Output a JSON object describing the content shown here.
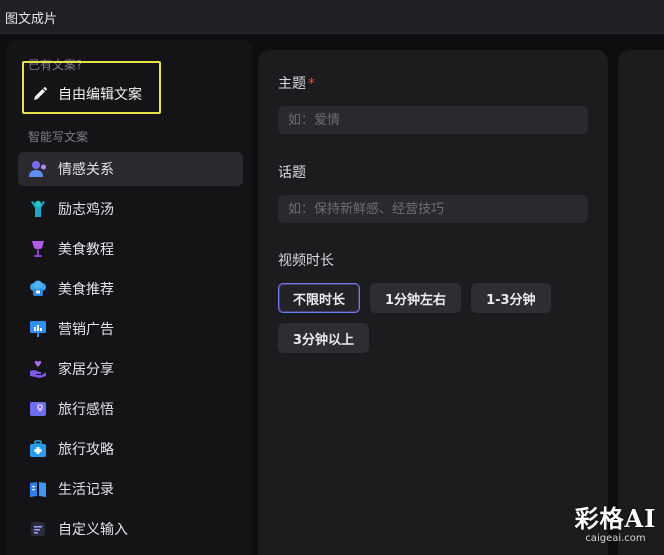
{
  "window": {
    "title": "图文成片"
  },
  "sidebar": {
    "has_copy_label": "已有文案?",
    "free_edit_label": "自由编辑文案",
    "smart_label": "智能写文案",
    "items": [
      {
        "label": "情感关系",
        "icon": "people-icon",
        "active": true
      },
      {
        "label": "励志鸡汤",
        "icon": "person-cheer-icon",
        "active": false
      },
      {
        "label": "美食教程",
        "icon": "wine-glass-icon",
        "active": false
      },
      {
        "label": "美食推荐",
        "icon": "chef-hat-icon",
        "active": false
      },
      {
        "label": "营销广告",
        "icon": "presentation-icon",
        "active": false
      },
      {
        "label": "家居分享",
        "icon": "hand-heart-icon",
        "active": false
      },
      {
        "label": "旅行感悟",
        "icon": "map-pin-icon",
        "active": false
      },
      {
        "label": "旅行攻略",
        "icon": "suitcase-icon",
        "active": false
      },
      {
        "label": "生活记录",
        "icon": "book-icon",
        "active": false
      },
      {
        "label": "自定义输入",
        "icon": "text-lines-icon",
        "active": false
      }
    ]
  },
  "form": {
    "topic_label": "主题",
    "required_mark": "*",
    "topic_placeholder": "如：爱情",
    "subject_label": "话题",
    "subject_placeholder": "如：保持新鲜感、经营技巧",
    "duration_label": "视频时长",
    "duration_options": [
      "不限时长",
      "1分钟左右",
      "1-3分钟",
      "3分钟以上"
    ],
    "duration_selected": "不限时长"
  },
  "watermark": {
    "main": "彩格AI",
    "sub": "caigeai.com"
  },
  "colors": {
    "accent_border": "#6b7cf2",
    "highlight_box": "#e9e14b",
    "required": "#e5484d"
  }
}
